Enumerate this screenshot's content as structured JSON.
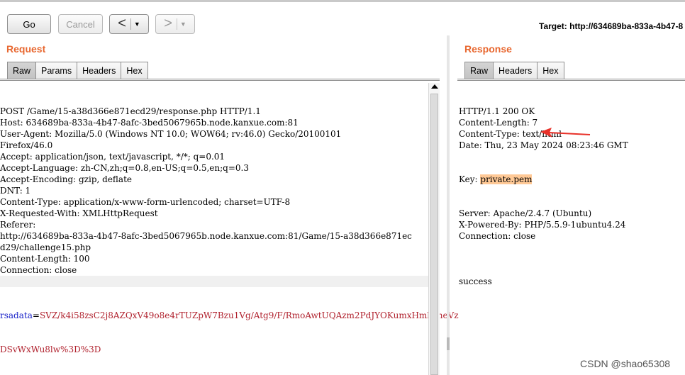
{
  "toolbar": {
    "go_label": "Go",
    "cancel_label": "Cancel",
    "back_arrow": "<",
    "forward_arrow": ">",
    "dropdown_glyph": "▼",
    "target_text": "Target: http://634689ba-833a-4b47-8"
  },
  "request": {
    "title": "Request",
    "tabs": [
      "Raw",
      "Params",
      "Headers",
      "Hex"
    ],
    "active_tab": "Raw",
    "lines": [
      "POST /Game/15-a38d366e871ecd29/response.php HTTP/1.1",
      "Host: 634689ba-833a-4b47-8afc-3bed5067965b.node.kanxue.com:81",
      "User-Agent: Mozilla/5.0 (Windows NT 10.0; WOW64; rv:46.0) Gecko/20100101",
      "Firefox/46.0",
      "Accept: application/json, text/javascript, */*; q=0.01",
      "Accept-Language: zh-CN,zh;q=0.8,en-US;q=0.5,en;q=0.3",
      "Accept-Encoding: gzip, deflate",
      "DNT: 1",
      "Content-Type: application/x-www-form-urlencoded; charset=UTF-8",
      "X-Requested-With: XMLHttpRequest",
      "Referer:",
      "http://634689ba-833a-4b47-8afc-3bed5067965b.node.kanxue.com:81/Game/15-a38d366e871ec",
      "d29/challenge15.php",
      "Content-Length: 100",
      "Connection: close",
      ""
    ],
    "body_param_name": "rsadata",
    "body_equals": "=",
    "body_value_line1": "SVZ/k4i58zsC2j8AZQxV49o8e4rTUZpW7Bzu1Vg/Atg9/F/RmoAwtUQAzm2PdJYOKumxHmkoneVz",
    "body_value_line2": "DSvWxWu8lw%3D%3D"
  },
  "response": {
    "title": "Response",
    "tabs": [
      "Raw",
      "Headers",
      "Hex"
    ],
    "active_tab": "Raw",
    "lines_before_key": [
      "HTTP/1.1 200 OK",
      "Content-Length: 7",
      "Content-Type: text/html",
      "Date: Thu, 23 May 2024 08:23:46 GMT"
    ],
    "key_label": "Key: ",
    "key_value": "private.pem",
    "lines_after_key": [
      "Server: Apache/2.4.7 (Ubuntu)",
      "X-Powered-By: PHP/5.5.9-1ubuntu4.24",
      "Connection: close",
      ""
    ],
    "body_text": "success",
    "annotation_color": "#e8322a",
    "key_highlight_color": "#ffc996"
  },
  "colors": {
    "panel_title": "#e8672f",
    "param_name": "#1a23c9",
    "param_value": "#b0212d"
  },
  "watermark": "CSDN @shao65308"
}
